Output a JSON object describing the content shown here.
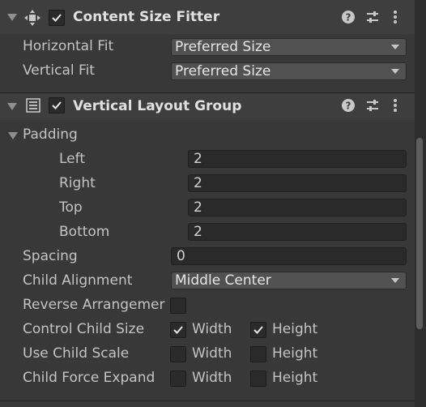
{
  "content_size_fitter": {
    "title": "Content Size Fitter",
    "horizontal_fit_label": "Horizontal Fit",
    "horizontal_fit_value": "Preferred Size",
    "vertical_fit_label": "Vertical Fit",
    "vertical_fit_value": "Preferred Size"
  },
  "vertical_layout_group": {
    "title": "Vertical Layout Group",
    "padding_label": "Padding",
    "left_label": "Left",
    "left_value": "2",
    "right_label": "Right",
    "right_value": "2",
    "top_label": "Top",
    "top_value": "2",
    "bottom_label": "Bottom",
    "bottom_value": "2",
    "spacing_label": "Spacing",
    "spacing_value": "0",
    "child_alignment_label": "Child Alignment",
    "child_alignment_value": "Middle Center",
    "reverse_label": "Reverse Arrangemer",
    "control_child_size_label": "Control Child Size",
    "use_child_scale_label": "Use Child Scale",
    "child_force_expand_label": "Child Force Expand",
    "width_label": "Width",
    "height_label": "Height",
    "control_child_size_width": true,
    "control_child_size_height": true,
    "use_child_scale_width": false,
    "use_child_scale_height": false,
    "child_force_expand_width": false,
    "child_force_expand_height": false,
    "reverse_arrangement": false
  },
  "icons": {
    "help": "help-icon",
    "presets": "presets-icon",
    "menu": "kebab-menu-icon",
    "fitter": "content-size-fitter-icon",
    "layout": "vertical-layout-icon"
  },
  "colors": {
    "panel_bg": "#383838",
    "header_bg": "#3e3e3e",
    "field_bg": "#2a2a2a",
    "dropdown_bg": "#515151"
  }
}
